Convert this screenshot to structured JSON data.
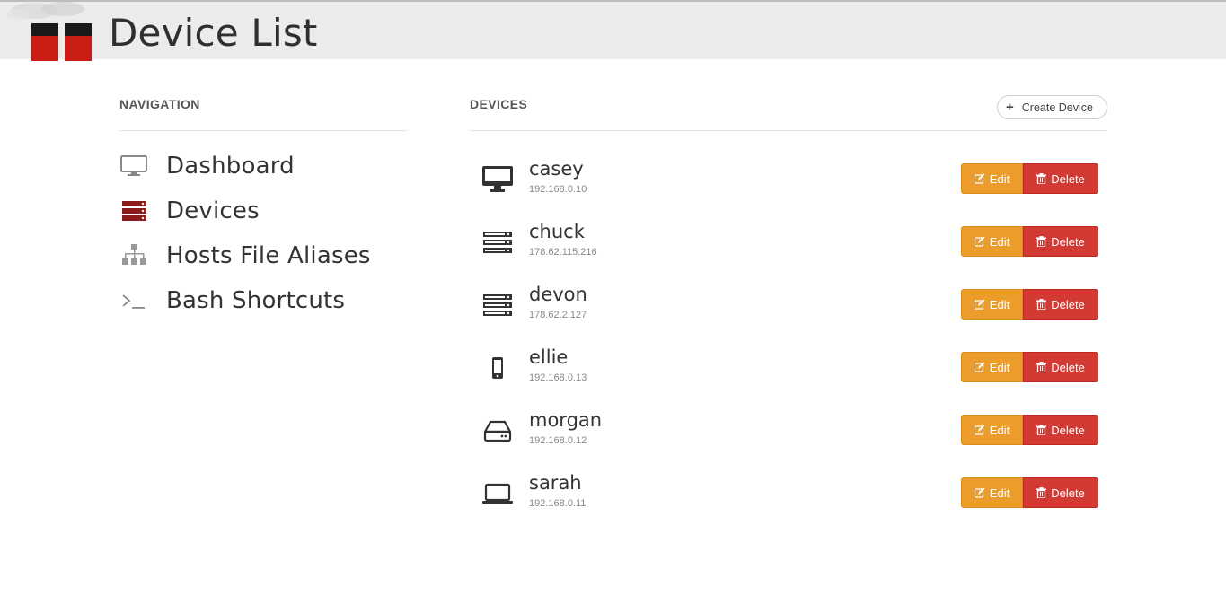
{
  "header": {
    "title": "Device List"
  },
  "navigation": {
    "heading": "NAVIGATION",
    "items": [
      {
        "label": "Dashboard",
        "icon": "monitor-icon"
      },
      {
        "label": "Devices",
        "icon": "server-icon",
        "active": true,
        "color": "#8b1a1a"
      },
      {
        "label": "Hosts File Aliases",
        "icon": "sitemap-icon"
      },
      {
        "label": "Bash Shortcuts",
        "icon": "terminal-icon"
      }
    ]
  },
  "devices": {
    "heading": "DEVICES",
    "create_label": "Create Device",
    "edit_label": "Edit",
    "delete_label": "Delete",
    "rows": [
      {
        "name": "casey",
        "ip": "192.168.0.10",
        "icon": "desktop-icon"
      },
      {
        "name": "chuck",
        "ip": "178.62.115.216",
        "icon": "server-icon"
      },
      {
        "name": "devon",
        "ip": "178.62.2.127",
        "icon": "server-icon"
      },
      {
        "name": "ellie",
        "ip": "192.168.0.13",
        "icon": "mobile-icon"
      },
      {
        "name": "morgan",
        "ip": "192.168.0.12",
        "icon": "hard-drive-icon"
      },
      {
        "name": "sarah",
        "ip": "192.168.0.11",
        "icon": "laptop-icon"
      }
    ]
  },
  "colors": {
    "edit": "#eb9c2b",
    "delete": "#d33a33",
    "header_bg": "#ececec"
  }
}
